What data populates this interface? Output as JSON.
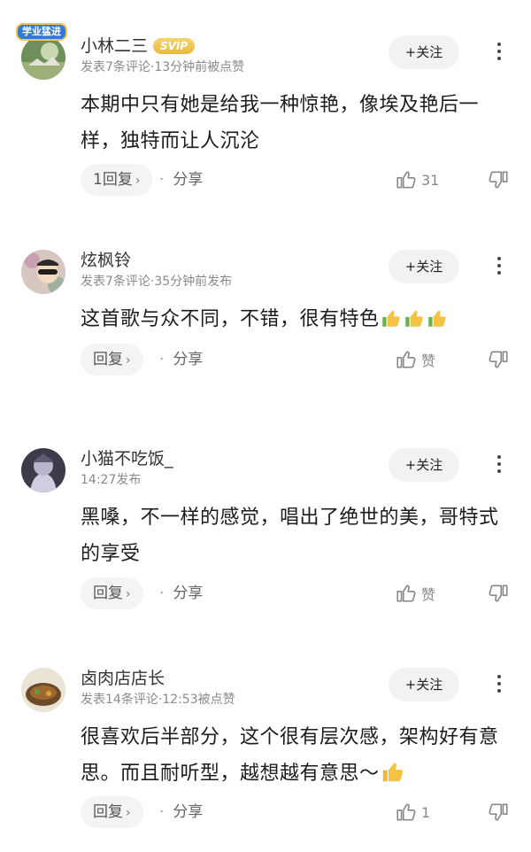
{
  "comments": [
    {
      "username": "小林二三",
      "vip_badge": "SVIP",
      "avatar_badge": "学业猛进",
      "meta": "发表7条评论·13分钟前被点赞",
      "follow_label": "+关注",
      "text": "本期中只有她是给我一种惊艳，像埃及艳后一样，独特而让人沉沦",
      "thumbs_emoji_count": 0,
      "reply_label": "1回复",
      "share_label": "分享",
      "like_count": "31"
    },
    {
      "username": "炫枫铃",
      "meta": "发表7条评论·35分钟前发布",
      "follow_label": "+关注",
      "text": "这首歌与众不同，不错，很有特色",
      "thumbs_emoji_count": 3,
      "reply_label": "回复",
      "share_label": "分享",
      "like_count": "赞"
    },
    {
      "username": "小猫不吃饭_",
      "meta": "14:27发布",
      "follow_label": "+关注",
      "text": "黑嗓，不一样的感觉，唱出了绝世的美，哥特式的享受",
      "thumbs_emoji_count": 0,
      "reply_label": "回复",
      "share_label": "分享",
      "like_count": "赞"
    },
    {
      "username": "卤肉店店长",
      "meta": "发表14条评论·12:53被点赞",
      "follow_label": "+关注",
      "text": "很喜欢后半部分，这个很有层次感，架构好有意思。而且耐听型，越想越有意思～",
      "thumbs_emoji_count": 1,
      "reply_label": "回复",
      "share_label": "分享",
      "like_count": "1"
    }
  ],
  "colors": {
    "svip_gold": "#e7b93d",
    "button_bg": "#f2f2f2",
    "meta_gray": "#8a8a8a"
  },
  "icons": [
    "thumbs-up-icon",
    "thumbs-down-icon",
    "more-vertical-icon",
    "chevron-right-icon",
    "thumbs-up-emoji"
  ]
}
